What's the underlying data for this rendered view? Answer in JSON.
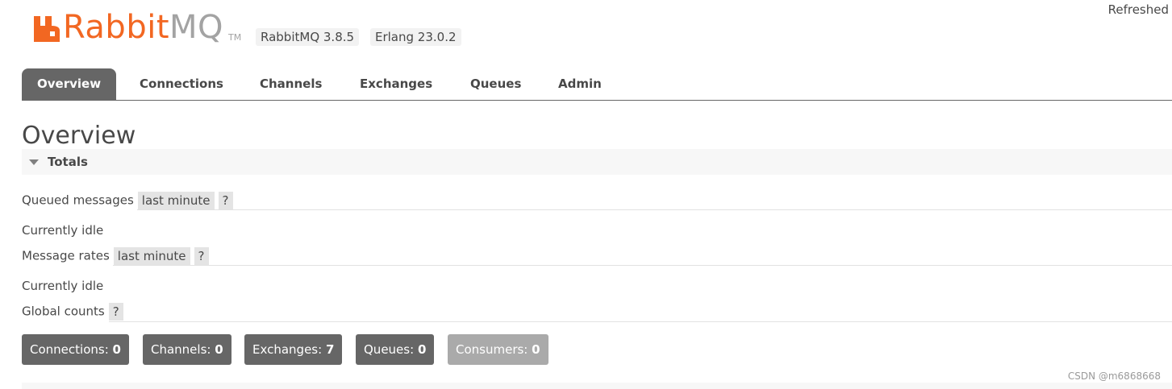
{
  "header": {
    "logo_rabbit": "Rabbit",
    "logo_mq": "MQ",
    "logo_tm": "TM",
    "rabbitmq_version": "RabbitMQ 3.8.5",
    "erlang_version": "Erlang 23.0.2",
    "refreshed": "Refreshed"
  },
  "tabs": [
    {
      "label": "Overview",
      "active": true
    },
    {
      "label": "Connections"
    },
    {
      "label": "Channels"
    },
    {
      "label": "Exchanges"
    },
    {
      "label": "Queues"
    },
    {
      "label": "Admin"
    }
  ],
  "overview": {
    "title": "Overview",
    "totals_label": "Totals",
    "queued_messages": {
      "label": "Queued messages",
      "range": "last minute",
      "help": "?"
    },
    "queued_status": "Currently idle",
    "message_rates": {
      "label": "Message rates",
      "range": "last minute",
      "help": "?"
    },
    "rates_status": "Currently idle",
    "global_counts": {
      "label": "Global counts",
      "help": "?"
    },
    "counts": [
      {
        "label": "Connections:",
        "value": "0"
      },
      {
        "label": "Channels:",
        "value": "0"
      },
      {
        "label": "Exchanges:",
        "value": "7"
      },
      {
        "label": "Queues:",
        "value": "0"
      },
      {
        "label": "Consumers:",
        "value": "0"
      }
    ]
  },
  "watermark": "CSDN @m6868668",
  "colors": {
    "brand_orange": "#f26722",
    "tab_active": "#666666",
    "count_box": "#666666",
    "count_box_disabled": "#aaaaaa"
  }
}
